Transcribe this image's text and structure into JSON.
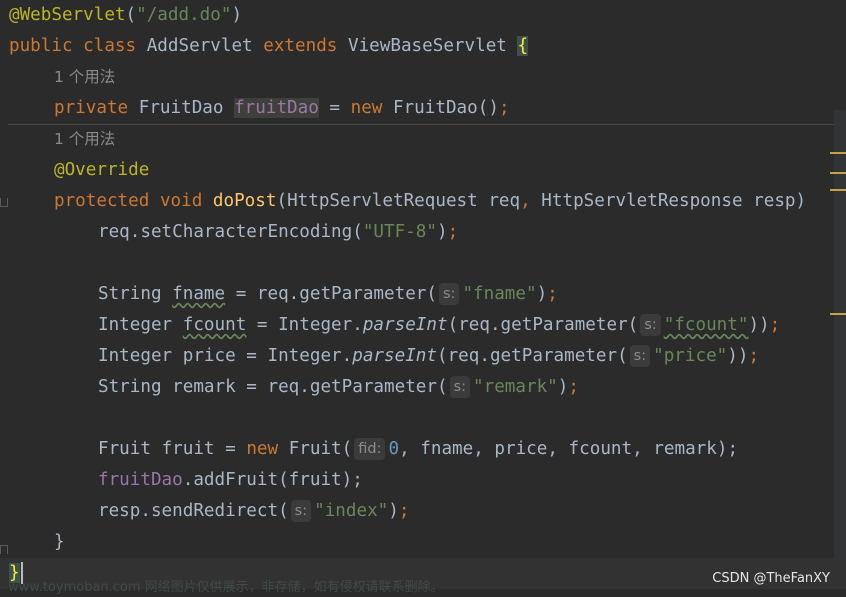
{
  "code": {
    "annotation_webservlet": "@WebServlet",
    "servlet_path": "\"/add.do\"",
    "kw_public": "public",
    "kw_class": "class",
    "class_name": "AddServlet",
    "kw_extends": "extends",
    "superclass": "ViewBaseServlet",
    "open_brace": "{",
    "usage_hint_1": "1 个用法",
    "kw_private": "private",
    "type_fruitdao": "FruitDao",
    "field_fruitdao": "fruitDao",
    "kw_new": "new",
    "ctor_fruitdao": "FruitDao",
    "usage_hint_2": "1 个用法",
    "annotation_override": "@Override",
    "kw_protected": "protected",
    "kw_void": "void",
    "method_name": "doPost",
    "param_type_req": "HttpServletRequest",
    "param_req": "req",
    "param_type_resp": "HttpServletResponse",
    "param_resp": "resp",
    "line_set_encoding": "req.setCharacterEncoding(",
    "str_utf8": "\"UTF-8\"",
    "type_string": "String",
    "var_fname": "fname",
    "call_get_parameter": "req.getParameter(",
    "hint_s": "s:",
    "str_fname": "\"fname\"",
    "type_integer": "Integer",
    "var_fcount": "fcount",
    "integer_class": "Integer.",
    "static_parseint": "parseInt",
    "str_fcount": "\"fcount\"",
    "var_price": "price",
    "str_price": "\"price\"",
    "var_remark": "remark",
    "str_remark": "\"remark\"",
    "type_fruit": "Fruit",
    "var_fruit": "fruit",
    "ctor_fruit": "Fruit(",
    "hint_fid": "fid:",
    "num_zero": "0",
    "fruit_args": ", fname, price, fcount, remark);",
    "add_fruit_call": ".addFruit(fruit);",
    "send_redirect_call": "resp.sendRedirect(",
    "str_index": "\"index\"",
    "close_brace": "}"
  },
  "watermark": "www.toymoban.com 网络图片仅供展示，非存储，如有侵权请联系删除。",
  "csdn_credit": "CSDN @TheFanXY",
  "colors": {
    "background": "#2b2b2b",
    "keyword": "#cc7832",
    "string": "#6a8759",
    "annotation": "#bbb529",
    "field": "#9876aa",
    "method_decl": "#ffc66d",
    "number": "#6897bb",
    "default_text": "#a9b7c6"
  }
}
